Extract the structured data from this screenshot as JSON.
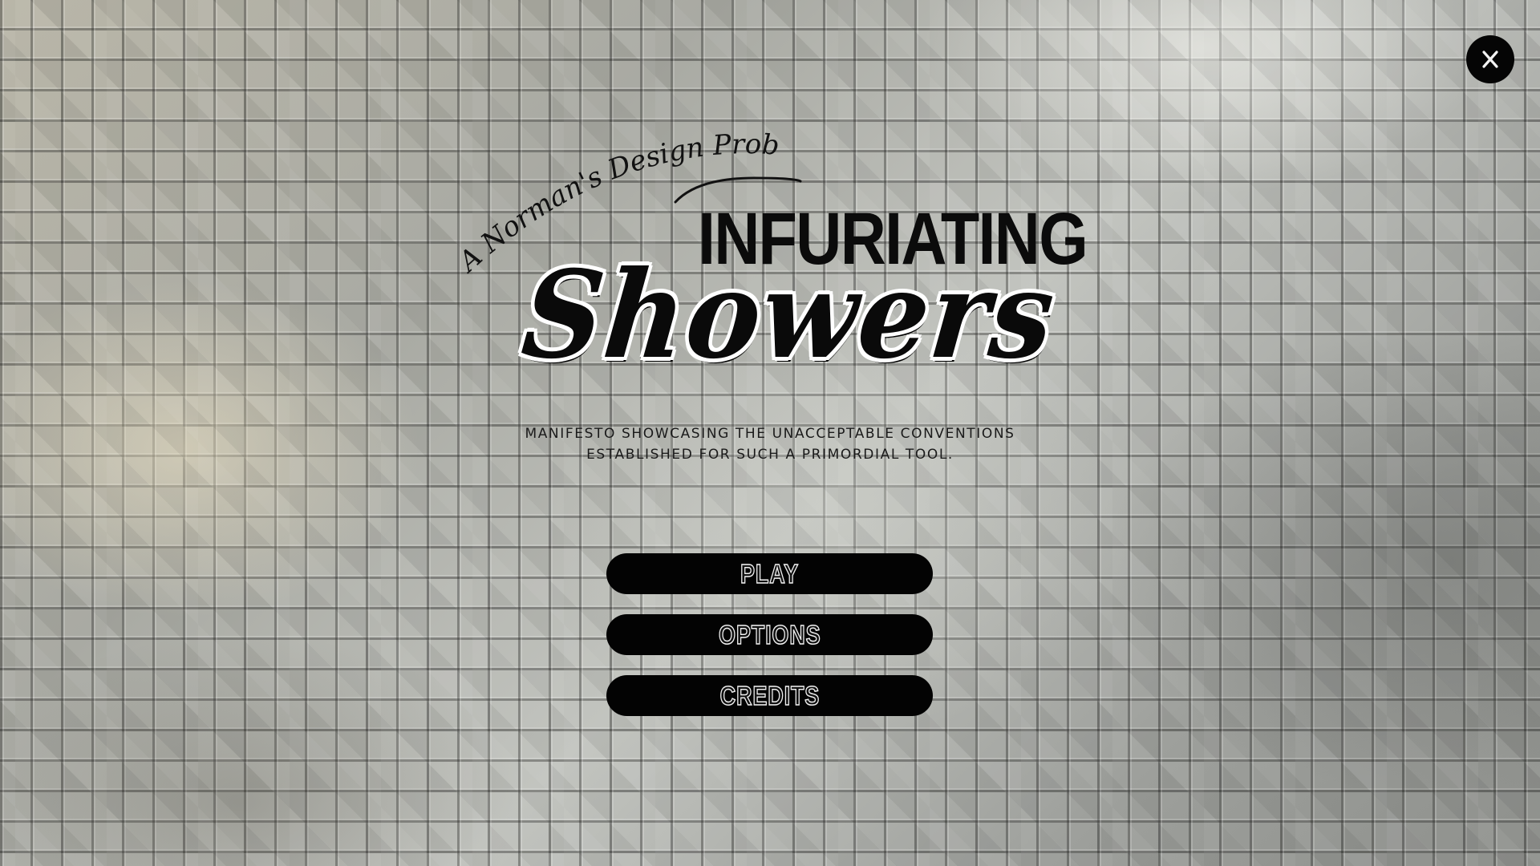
{
  "game": {
    "tagline": "A Norman's Design Problem",
    "title_top": "INFURIATING",
    "title_script": "Showers",
    "description_line1": "MANIFESTO SHOWCASING THE UNACCEPTABLE CONVENTIONS",
    "description_line2": "ESTABLISHED FOR SUCH A PRIMORDIAL TOOL."
  },
  "menu": {
    "play_label": "PLAY",
    "options_label": "OPTIONS",
    "credits_label": "CREDITS"
  },
  "window": {
    "close_icon": "close-x-icon"
  },
  "colors": {
    "button_bg": "#030303",
    "button_text": "#f0f0f0",
    "title_text": "#0b0b0b",
    "background": "#a6a8a2"
  }
}
